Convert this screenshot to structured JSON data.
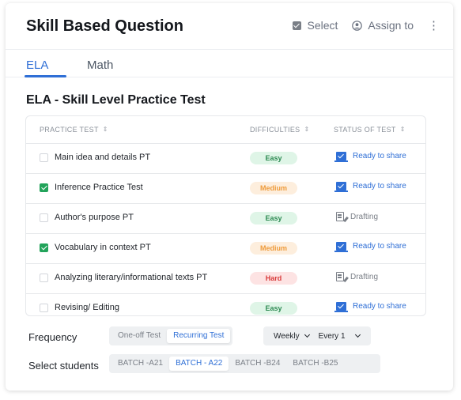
{
  "header": {
    "title": "Skill Based Question",
    "select_label": "Select",
    "assign_label": "Assign to",
    "more_icon": "more-vertical-icon"
  },
  "tabs": [
    {
      "label": "ELA",
      "active": true
    },
    {
      "label": "Math",
      "active": false
    }
  ],
  "section_title": "ELA - Skill Level Practice Test",
  "table": {
    "columns": [
      "PRACTICE TEST",
      "DIFFICULTIES",
      "STATUS OF TEST"
    ],
    "sort_icon": "⇕",
    "rows": [
      {
        "checked": false,
        "name": "Main idea and details PT",
        "difficulty": "Easy",
        "status": "Ready to share"
      },
      {
        "checked": true,
        "name": "Inference Practice Test",
        "difficulty": "Medium",
        "status": "Ready to share"
      },
      {
        "checked": false,
        "name": "Author's purpose PT",
        "difficulty": "Easy",
        "status": "Drafting"
      },
      {
        "checked": true,
        "name": "Vocabulary in context PT",
        "difficulty": "Medium",
        "status": "Ready to share"
      },
      {
        "checked": false,
        "name": "Analyzing literary/informational texts PT",
        "difficulty": "Hard",
        "status": "Drafting"
      },
      {
        "checked": false,
        "name": "Revising/ Editing",
        "difficulty": "Easy",
        "status": "Ready to share"
      }
    ]
  },
  "frequency": {
    "label": "Frequency",
    "options": [
      "One-off Test",
      "Recurring Test"
    ],
    "selected": "Recurring Test",
    "interval": "Weekly",
    "every": "Every 1"
  },
  "students": {
    "label": "Select students",
    "batches": [
      "BATCH -A21",
      "BATCH - A22",
      "BATCH -B24",
      "BATCH -B25"
    ],
    "selected": "BATCH - A22"
  },
  "colors": {
    "accent": "#2f6fd6",
    "check_green": "#22a35a",
    "easy": "#2d8a52",
    "medium": "#ee9b3b",
    "hard": "#d83a3a"
  }
}
